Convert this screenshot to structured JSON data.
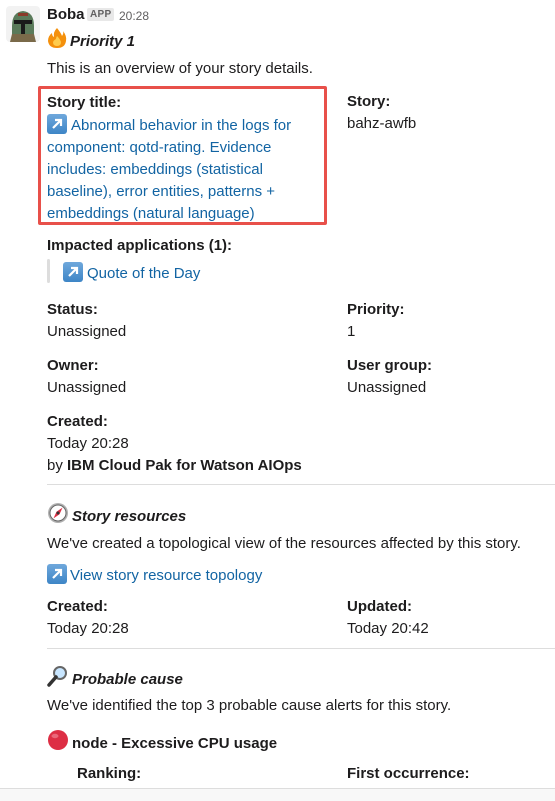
{
  "message": {
    "sender": "Boba",
    "badge": "APP",
    "time": "20:28",
    "priority_heading": "Priority 1",
    "intro": "This is an overview of your story details."
  },
  "story": {
    "title_label": "Story title:",
    "title_link": "Abnormal behavior in the logs for component: qotd-rating. Evidence includes: embeddings (statistical baseline), error entities, patterns + embeddings (natural language)",
    "id_label": "Story:",
    "id_value": "bahz-awfb",
    "impacted_label": "Impacted applications (1):",
    "impacted_app": "Quote of the Day",
    "status_label": "Status:",
    "status_value": "Unassigned",
    "priority_label": "Priority:",
    "priority_value": "1",
    "owner_label": "Owner:",
    "owner_value": "Unassigned",
    "group_label": "User group:",
    "group_value": "Unassigned",
    "created_label": "Created:",
    "created_value": "Today 20:28",
    "created_by_prefix": "by ",
    "created_by": "IBM Cloud Pak for Watson AIOps"
  },
  "resources": {
    "heading": "Story resources",
    "description": "We've created a topological view of the resources affected by this story.",
    "link": "View story resource topology",
    "created_label": "Created:",
    "created_value": "Today 20:28",
    "updated_label": "Updated:",
    "updated_value": "Today 20:42"
  },
  "probable_cause": {
    "heading": "Probable cause",
    "description": "We've identified the top 3 probable cause alerts for this story.",
    "alert_title": "node - Excessive CPU usage",
    "ranking_label": "Ranking:",
    "first_occurrence_label": "First occurrence:"
  },
  "icons": {
    "fire": "fire-icon",
    "link_arrow": "external-link-arrow-icon",
    "compass": "compass-icon",
    "magnifier": "magnifying-glass-icon",
    "red_circle": "red-circle-icon"
  },
  "colors": {
    "link": "#1264a3",
    "highlight_border": "#e8504a",
    "alert_red": "#dd2e44"
  }
}
